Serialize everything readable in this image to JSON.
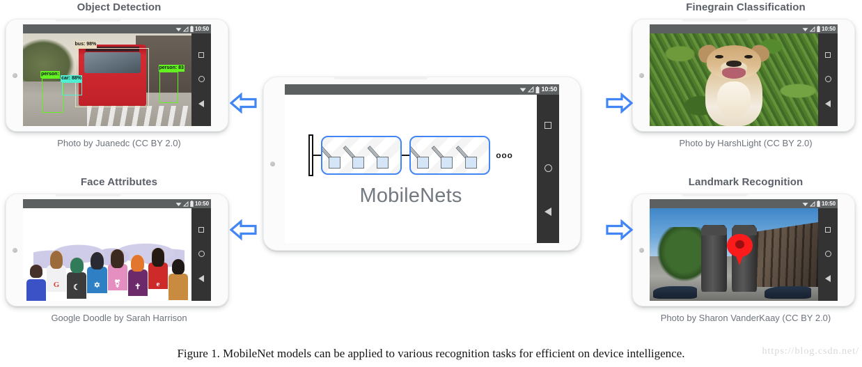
{
  "figure": {
    "caption": "Figure 1. MobileNet models can be applied to various recognition tasks for efficient on device intelligence.",
    "watermark": "https://blog.csdn.net/"
  },
  "colors": {
    "arrow_blue": "#4285f4",
    "block_blue": "#4285f4",
    "title_gray": "#5b6068",
    "caption_gray": "#6d737c",
    "statusbar_gray": "#5d6061",
    "navbar_dark": "#333333",
    "pin_red": "#fc1b1b"
  },
  "status_bar": {
    "clock": "10:50",
    "icons": [
      "wifi-icon",
      "signal-icon",
      "battery-icon"
    ]
  },
  "nav_bar": {
    "items": [
      "recents-button",
      "home-button",
      "back-button"
    ]
  },
  "center_phone": {
    "label": "MobileNets",
    "ellipsis": "ooo",
    "blocks": [
      {
        "name": "conv-block-1",
        "filters": 3
      },
      {
        "name": "conv-block-2",
        "filters": 3
      }
    ]
  },
  "panels": [
    {
      "id": "object-detection",
      "title": "Object Detection",
      "caption": "Photo by Juanedc (CC BY 2.0)",
      "arrow": "arrow-left",
      "detections": [
        {
          "label": "bus: 98%",
          "color": "#e9dcc0"
        },
        {
          "label": "person:",
          "color": "#62f321"
        },
        {
          "label": "car: 88%",
          "color": "#4ff0d2"
        },
        {
          "label": "person: 83",
          "color": "#62f321"
        }
      ]
    },
    {
      "id": "face-attributes",
      "title": "Face Attributes",
      "caption": "Google Doodle by Sarah Harrison",
      "arrow": "arrow-left"
    },
    {
      "id": "finegrain-classification",
      "title": "Finegrain Classification",
      "caption": "Photo by HarshLight (CC BY 2.0)",
      "arrow": "arrow-right"
    },
    {
      "id": "landmark-recognition",
      "title": "Landmark Recognition",
      "caption": "Photo by Sharon VanderKaay (CC BY 2.0)",
      "arrow": "arrow-right"
    }
  ]
}
